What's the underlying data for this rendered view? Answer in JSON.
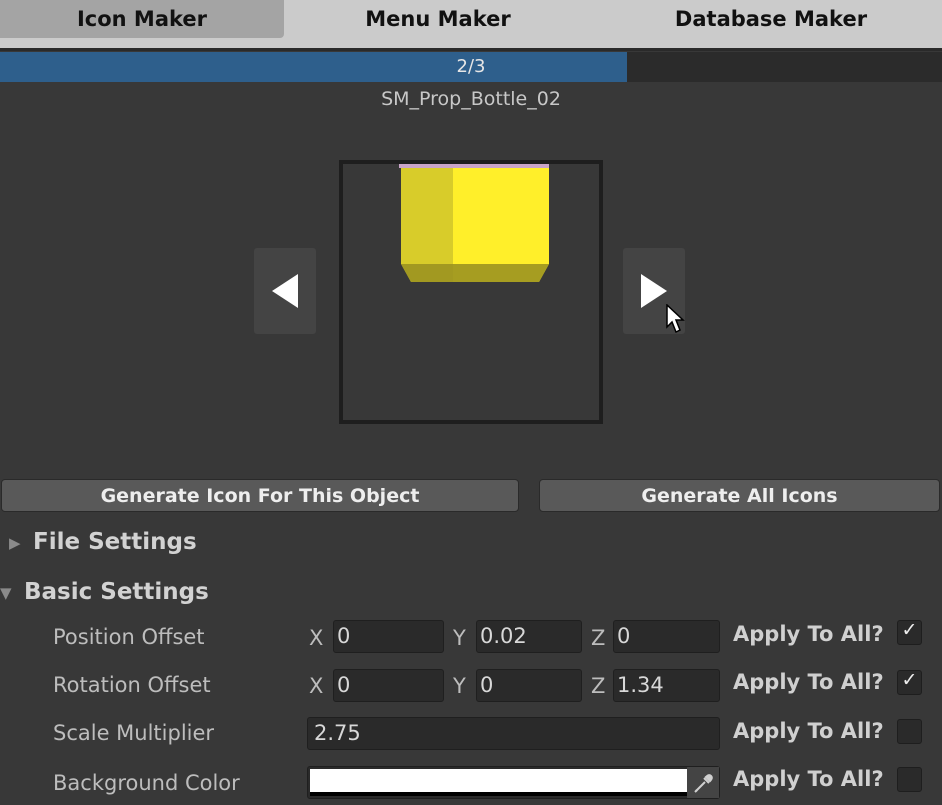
{
  "tabs": [
    "Icon Maker",
    "Menu Maker",
    "Database Maker"
  ],
  "progress": {
    "label": "2/3",
    "value": 0.667
  },
  "object_name": "SM_Prop_Bottle_02",
  "buttons": {
    "generate_one": "Generate Icon For This Object",
    "generate_all": "Generate All Icons"
  },
  "sections": {
    "file_settings": "File Settings",
    "basic_settings": "Basic Settings"
  },
  "axes": {
    "x": "X",
    "y": "Y",
    "z": "Z"
  },
  "apply_label": "Apply To All?",
  "rows": {
    "position_offset": {
      "label": "Position Offset",
      "x": "0",
      "y": "0.02",
      "z": "0",
      "apply": true
    },
    "rotation_offset": {
      "label": "Rotation Offset",
      "x": "0",
      "y": "0",
      "z": "1.34",
      "apply": true
    },
    "scale_multiplier": {
      "label": "Scale Multiplier",
      "value": "2.75",
      "apply": false
    },
    "background_color": {
      "label": "Background Color",
      "color": "#ffffff",
      "apply": false
    }
  },
  "colors": {
    "accent": "#2e5f8c",
    "object": "#ffef2a"
  },
  "icons": {
    "prev": "triangle-left",
    "next": "triangle-right",
    "eyedropper": "eyedropper",
    "check": "checkmark"
  }
}
